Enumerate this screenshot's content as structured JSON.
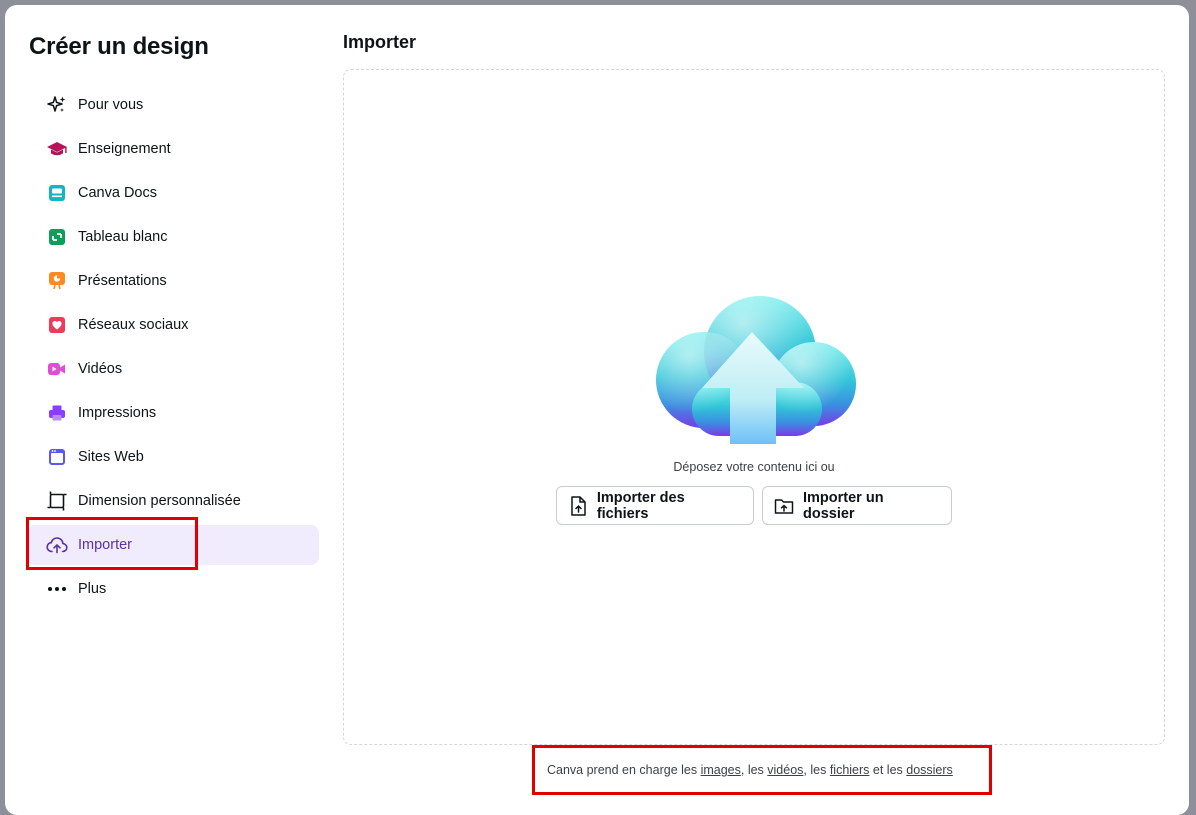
{
  "sidebar": {
    "title": "Créer un design",
    "items": [
      {
        "label": "Pour vous",
        "icon": "sparkles-icon"
      },
      {
        "label": "Enseignement",
        "icon": "graduation-cap-icon"
      },
      {
        "label": "Canva Docs",
        "icon": "docs-icon"
      },
      {
        "label": "Tableau blanc",
        "icon": "whiteboard-icon"
      },
      {
        "label": "Présentations",
        "icon": "presentation-icon"
      },
      {
        "label": "Réseaux sociaux",
        "icon": "heart-icon"
      },
      {
        "label": "Vidéos",
        "icon": "video-icon"
      },
      {
        "label": "Impressions",
        "icon": "printer-icon"
      },
      {
        "label": "Sites Web",
        "icon": "website-icon"
      },
      {
        "label": "Dimension personnalisée",
        "icon": "crop-icon"
      },
      {
        "label": "Importer",
        "icon": "cloud-upload-icon",
        "active": true
      },
      {
        "label": "Plus",
        "icon": "more-dots-icon"
      }
    ]
  },
  "main": {
    "title": "Importer",
    "drop_text": "Déposez votre contenu ici ou",
    "upload_files_label": "Importer des fichiers",
    "upload_folder_label": "Importer un dossier"
  },
  "footer": {
    "prefix": "Canva prend en charge les ",
    "images": "images",
    "sep1": ", les ",
    "videos": "vidéos",
    "sep2": ", les ",
    "files": "fichiers",
    "sep3": " et les ",
    "folders": "dossiers"
  },
  "colors": {
    "accent_purple": "#7d2ae8",
    "active_bg": "#f1ebfe",
    "highlight_red": "#e00000"
  }
}
